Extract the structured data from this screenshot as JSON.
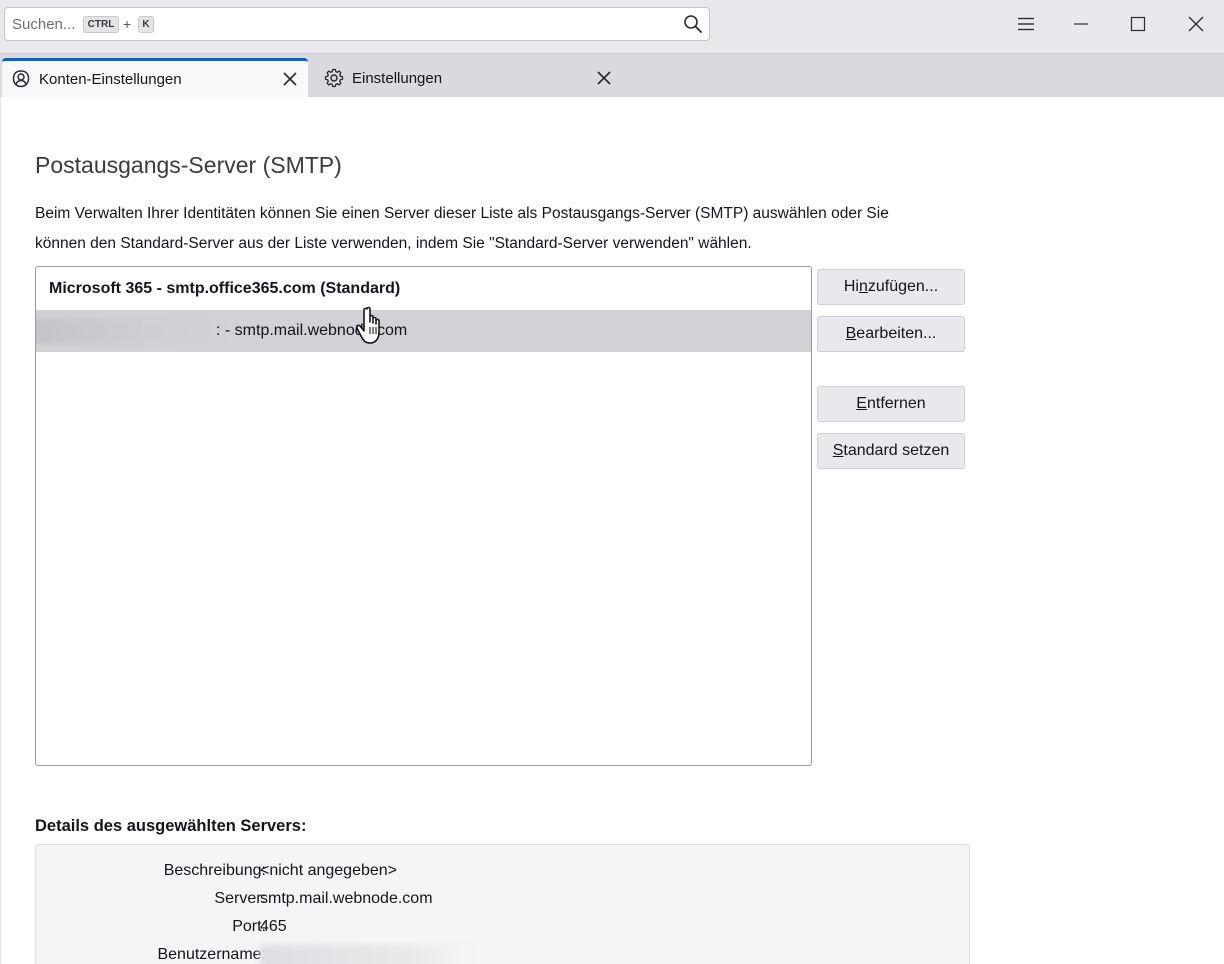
{
  "search": {
    "placeholder": "Suchen...",
    "shortcut_ctrl": "CTRL",
    "shortcut_plus": "+",
    "shortcut_key": "K"
  },
  "tabs": [
    {
      "label": "Konten-Einstellungen",
      "icon": "account-icon",
      "active": true
    },
    {
      "label": "Einstellungen",
      "icon": "gear-icon",
      "active": false
    }
  ],
  "page": {
    "title": "Postausgangs-Server (SMTP)",
    "description": "Beim Verwalten Ihrer Identitäten können Sie einen Server dieser Liste als Postausgangs-Server (SMTP) auswählen oder Sie können den Standard-Server aus der Liste verwenden, indem Sie \"Standard-Server verwenden\" wählen."
  },
  "servers": [
    {
      "label": "Microsoft 365 - smtp.office365.com (Standard)",
      "selected": false
    },
    {
      "label": ": - smtp.mail.webnode.com",
      "selected": true
    }
  ],
  "buttons": {
    "add_pre": "Hi",
    "add_key": "n",
    "add_post": "zufügen...",
    "edit_key": "B",
    "edit_post": "earbeiten...",
    "remove_key": "E",
    "remove_post": "ntfernen",
    "default_key": "S",
    "default_post": "tandard setzen"
  },
  "details": {
    "title": "Details des ausgewählten Servers:",
    "rows": [
      {
        "label": "Beschreibung:",
        "value": "<nicht angegeben>"
      },
      {
        "label": "Server:",
        "value": "smtp.mail.webnode.com"
      },
      {
        "label": "Port:",
        "value": "465"
      },
      {
        "label": "Benutzername:",
        "value": ""
      }
    ]
  },
  "colors": {
    "accent": "#0060df",
    "selection": "#d1d1d6",
    "toolbar": "#e9e9ed"
  }
}
